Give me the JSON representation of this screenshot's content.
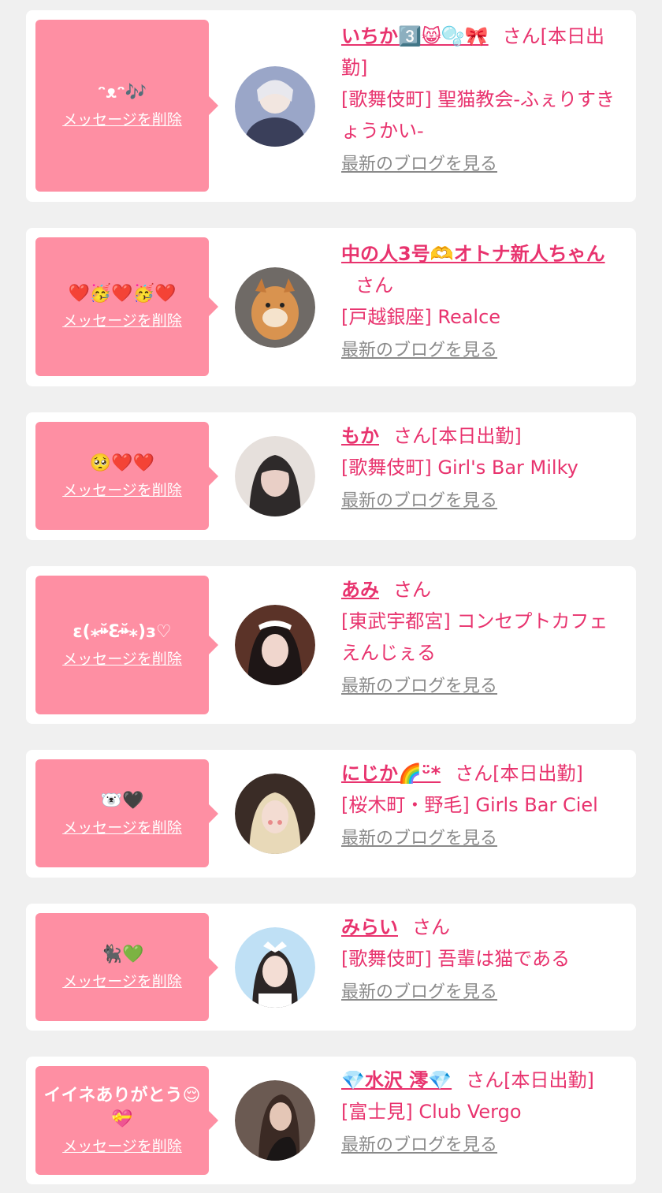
{
  "common": {
    "delete_label": "メッセージを削除",
    "blog_label": "最新のブログを見る"
  },
  "cards": [
    {
      "message": "ᵔᴥᵔ🎶",
      "name": "いちか3️⃣😸🫧🎀",
      "suffix": "さん[本日出勤]",
      "shop": "[歌舞伎町] 聖猫教会-ふぇりすきょうかい-",
      "avatar_color": "#9aa6c8"
    },
    {
      "message": "❤️🥳❤️🥳❤️",
      "name": "中の人3号🫶オトナ新人ちゃん",
      "suffix": "さん",
      "shop": "[戸越銀座] Realce",
      "avatar_color": "#c98a4e"
    },
    {
      "message": "🥺❤️❤️",
      "name": "もか",
      "suffix": "さん[本日出勤]",
      "shop": "[歌舞伎町] Girl's Bar Milky",
      "avatar_color": "#d8d0cc"
    },
    {
      "message": "ɛ(⁎⁍̴̆Ɛ⁍̴̆⁎)з♡",
      "name": "あみ",
      "suffix": "さん",
      "shop": "[東武宇都宮] コンセプトカフェ えんじぇる",
      "avatar_color": "#6b3b2e"
    },
    {
      "message": "🐻‍❄️🖤",
      "name": "にじか🌈ᵕ̈*",
      "suffix": "さん[本日出勤]",
      "shop": "[桜木町・野毛] Girls Bar Ciel",
      "avatar_color": "#b08f76"
    },
    {
      "message": "🐈‍⬛💚",
      "name": "みらい",
      "suffix": "さん",
      "shop": "[歌舞伎町] 吾輩は猫である",
      "avatar_color": "#a9d2f0"
    },
    {
      "message": "イイネありがとう😌💝",
      "name": "💎水沢 澪💎",
      "suffix": "さん[本日出勤]",
      "shop": "[富士見] Club Vergo",
      "avatar_color": "#5a4a44"
    }
  ]
}
